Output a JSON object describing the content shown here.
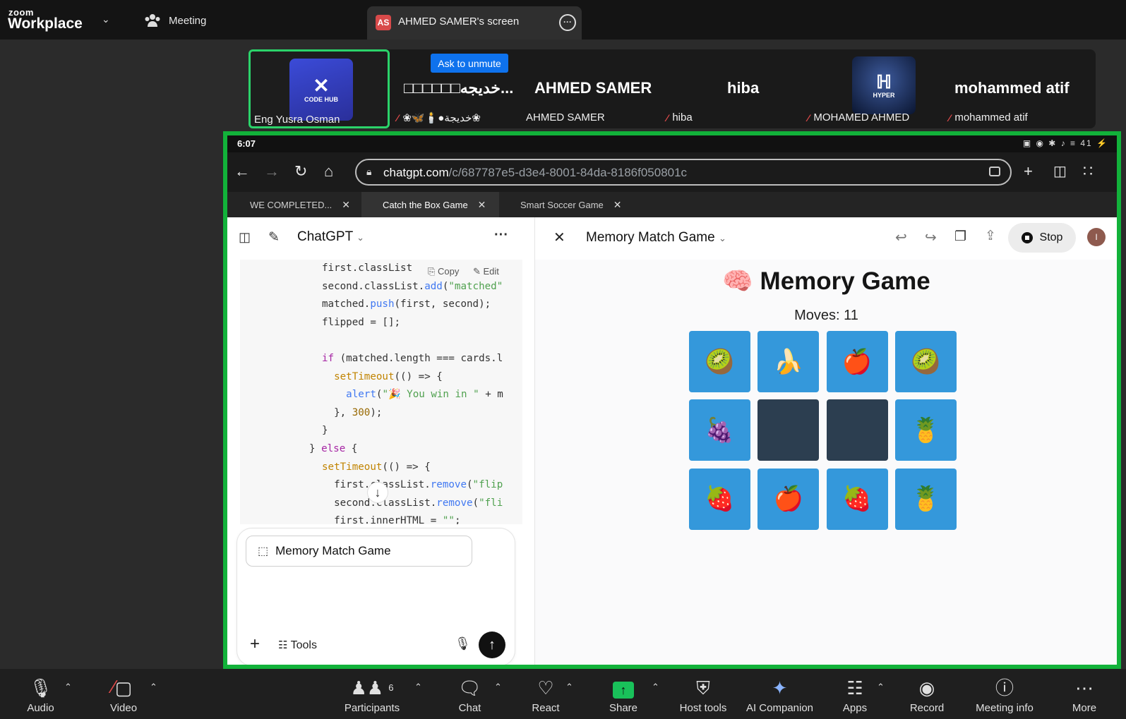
{
  "app": {
    "logo_small": "zoom",
    "logo_big": "Workplace",
    "meeting_label": "Meeting",
    "screen_tab": {
      "badge": "AS",
      "label": "AHMED SAMER's screen"
    }
  },
  "participants": [
    {
      "big_name": "",
      "footer": "Eng Yusra Osman",
      "logo_text": "CODE HUB",
      "active": true
    },
    {
      "big_name": "...خديجه□□□□□□",
      "footer": "❀🦋🕯️●خديجة❀",
      "mic_muted": true
    },
    {
      "big_name": "AHMED SAMER",
      "footer": "AHMED SAMER"
    },
    {
      "big_name": "hiba",
      "footer": "hiba",
      "mic_muted": true
    },
    {
      "big_name": "",
      "footer": "MOHAMED AHMED",
      "logo_text": "HYPER",
      "mic_muted": true
    },
    {
      "big_name": "mohammed atif",
      "footer": "mohammed atif",
      "mic_muted": true
    }
  ],
  "ask_to_unmute": "Ask to unmute",
  "phone_status": {
    "time": "6:07",
    "icons": "▣ ◉ ✱ ♪ ≡ 41 ⚡"
  },
  "browser": {
    "url_host": "chatgpt.com",
    "url_path": "/c/687787e5-d3e4-8001-84da-8186f050801c",
    "tabs": [
      {
        "label": "WE COMPLETED..."
      },
      {
        "label": "Catch the Box Game"
      },
      {
        "label": "Smart Soccer Game"
      }
    ]
  },
  "chat": {
    "title": "ChatGPT",
    "copy_label": "Copy",
    "edit_label": "Edit",
    "canvas_chip": "Memory Match Game",
    "tools_label": "Tools"
  },
  "canvas": {
    "title": "Memory Match Game",
    "stop_label": "Stop",
    "avatar_initial": "I",
    "game_title": "🧠 Memory Game",
    "moves_label": "Moves: 11",
    "cards": [
      [
        "🥝",
        "🍌",
        "🍎",
        "🥝"
      ],
      [
        "🍇",
        "",
        "",
        "🍍"
      ],
      [
        "🍓",
        "🍎",
        "🍓",
        "🍍"
      ]
    ],
    "card_colors": {
      "open": "#3498db",
      "hidden": "#2c3e50"
    }
  },
  "toolbar": {
    "audio": "Audio",
    "video": "Video",
    "participants": "Participants",
    "participants_count": "6",
    "chat": "Chat",
    "react": "React",
    "share": "Share",
    "host_tools": "Host tools",
    "ai_companion": "AI Companion",
    "apps": "Apps",
    "record": "Record",
    "meeting_info": "Meeting info",
    "more": "More"
  },
  "colors": {
    "share_border": "#12b23a",
    "active_tile": "#2bd36a",
    "ask_unmute": "#0e72ed",
    "share_button": "#19c15a"
  }
}
